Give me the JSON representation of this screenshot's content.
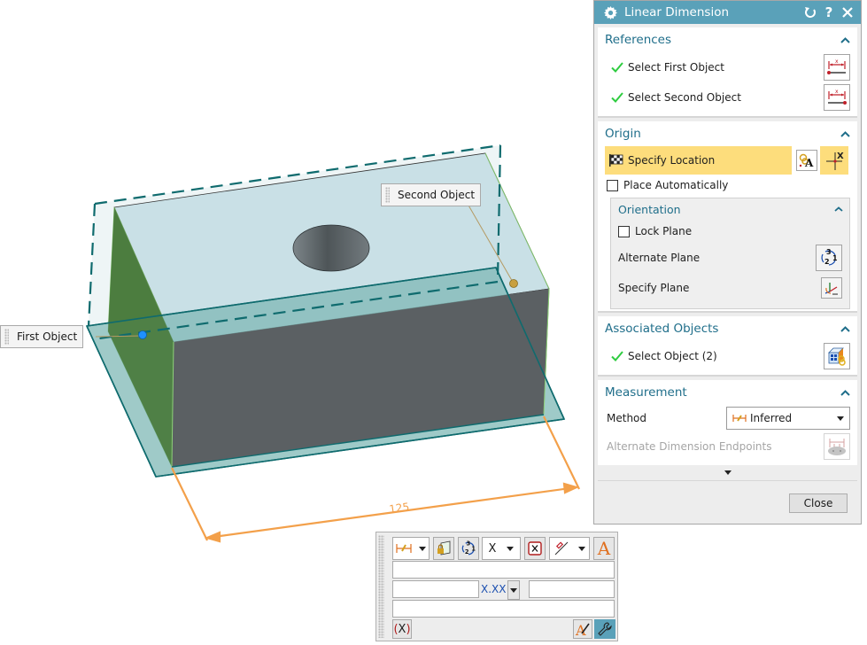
{
  "viewport": {
    "callouts": {
      "first_object": "First Object",
      "second_object": "Second Object"
    },
    "dimension_value": "125",
    "colors": {
      "top_face": "#c9e0e6",
      "front_face": "#5b6063",
      "side_face": "#4c7d3f",
      "plane": "#0f6b6e",
      "dimension": "#f3a04a",
      "first_point": "#1e90ff",
      "second_point": "#c8a040"
    }
  },
  "dialog": {
    "title": "Linear Dimension",
    "header_icons": [
      "gear-icon",
      "reset-icon",
      "help-icon",
      "close-icon"
    ],
    "sections": {
      "references": {
        "label": "References",
        "first": "Select First Object",
        "second": "Select Second Object"
      },
      "origin": {
        "label": "Origin",
        "specify_location": "Specify Location",
        "place_automatically": "Place Automatically",
        "place_automatically_checked": false,
        "orientation": {
          "label": "Orientation",
          "lock_plane": "Lock Plane",
          "lock_plane_checked": false,
          "alternate_plane": "Alternate Plane",
          "specify_plane": "Specify Plane"
        }
      },
      "associated": {
        "label": "Associated Objects",
        "select_object": "Select Object (2)"
      },
      "measurement": {
        "label": "Measurement",
        "method_label": "Method",
        "method_value": "Inferred",
        "alt_endpoints": "Alternate Dimension Endpoints"
      }
    },
    "close_label": "Close",
    "colors": {
      "titlebar": "#5aa1b9",
      "section_heading": "#1f6e8a",
      "highlight": "#fddd7c",
      "check": "#2ecc40"
    }
  },
  "mini_toolbar": {
    "tolerance_value": "X",
    "precision_label": "X.XX",
    "expression_label": "(X)",
    "text_value": "",
    "upper_value": "",
    "lower_value": "",
    "note_value": ""
  }
}
